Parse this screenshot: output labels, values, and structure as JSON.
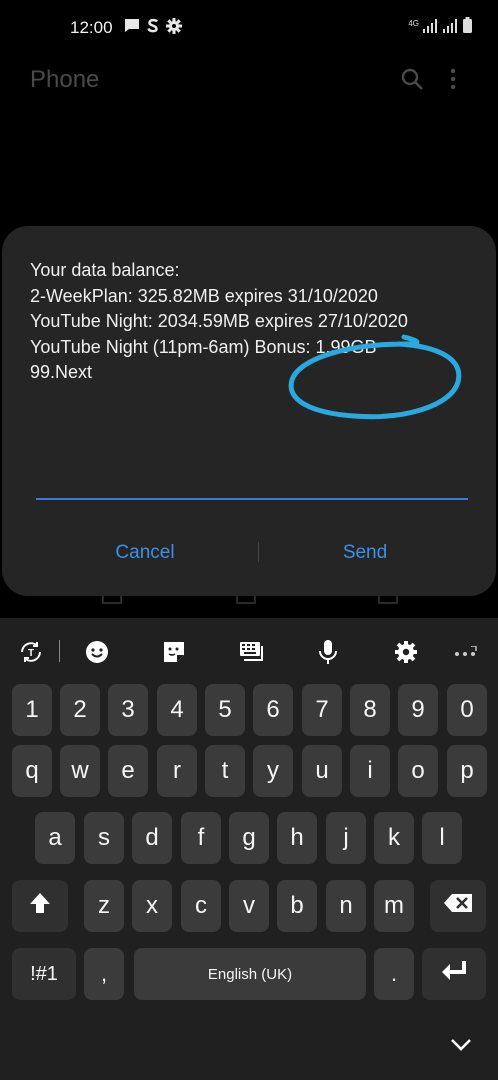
{
  "status_bar": {
    "time": "12:00",
    "network": "4G",
    "icons": [
      "message-icon",
      "skype-icon",
      "gear-icon",
      "signal-icon",
      "signal-icon",
      "battery-icon"
    ]
  },
  "app_bar": {
    "title": "Phone",
    "icons": [
      "search-icon",
      "more-vert-icon"
    ]
  },
  "dialog": {
    "message": "Your data balance:\n2-WeekPlan: 325.82MB expires 31/10/2020\nYouTube Night: 2034.59MB expires 27/10/2020\nYouTube Night (11pm-6am) Bonus: 1.99GB\n99.Next",
    "reply_value": "",
    "cancel_label": "Cancel",
    "send_label": "Send",
    "annotation_color": "#29a9e0"
  },
  "keyboard": {
    "toolbar_icons": [
      "translate-icon",
      "emoji-icon",
      "sticker-icon",
      "keyboard-layout-icon",
      "mic-icon",
      "gear-icon",
      "more-icon"
    ],
    "row_numbers": [
      "1",
      "2",
      "3",
      "4",
      "5",
      "6",
      "7",
      "8",
      "9",
      "0"
    ],
    "row_top": [
      "q",
      "w",
      "e",
      "r",
      "t",
      "y",
      "u",
      "i",
      "o",
      "p"
    ],
    "row_middle": [
      "a",
      "s",
      "d",
      "f",
      "g",
      "h",
      "j",
      "k",
      "l"
    ],
    "row_bottom": [
      "z",
      "x",
      "c",
      "v",
      "b",
      "n",
      "m"
    ],
    "shift_icon": "shift-icon",
    "backspace_icon": "backspace-icon",
    "symbols_label": "!#1",
    "comma_label": ",",
    "space_label": "English (UK)",
    "period_label": ".",
    "enter_icon": "enter-icon",
    "hide_icon": "chevron-down-icon",
    "accent": "#3e8fe8"
  }
}
